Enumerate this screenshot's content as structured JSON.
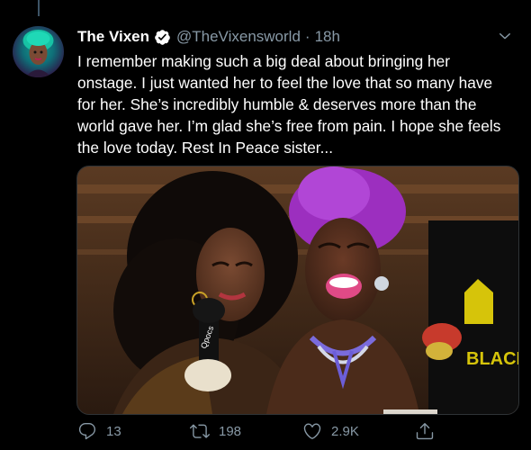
{
  "tweet": {
    "display_name": "The Vixen",
    "handle": "@TheVixensworld",
    "separator": "·",
    "time": "18h",
    "verified": true,
    "text_lines": [
      "I remember making such a big deal about bringing her",
      "onstage. I just wanted her to feel the love that so many have",
      "for her. She’s incredibly humble & deserves more than the",
      "world gave her. I’m glad she’s free from pain. I hope she feels",
      "the love today. Rest In Peace sister..."
    ],
    "media": {
      "photo_text": "BLACK",
      "mic_text": "Qpocs"
    }
  },
  "actions": {
    "reply_count": "13",
    "retweet_count": "198",
    "like_count": "2.9K"
  },
  "icons": {
    "verified": "verified-badge-icon",
    "caret": "chevron-down-icon",
    "reply": "reply-icon",
    "retweet": "retweet-icon",
    "like": "heart-icon",
    "share": "share-icon"
  },
  "colors": {
    "background": "#000000",
    "text_primary": "#ffffff",
    "text_secondary": "#8899a6",
    "verified_badge": "#ffffff",
    "thread_line": "#3d5466"
  }
}
